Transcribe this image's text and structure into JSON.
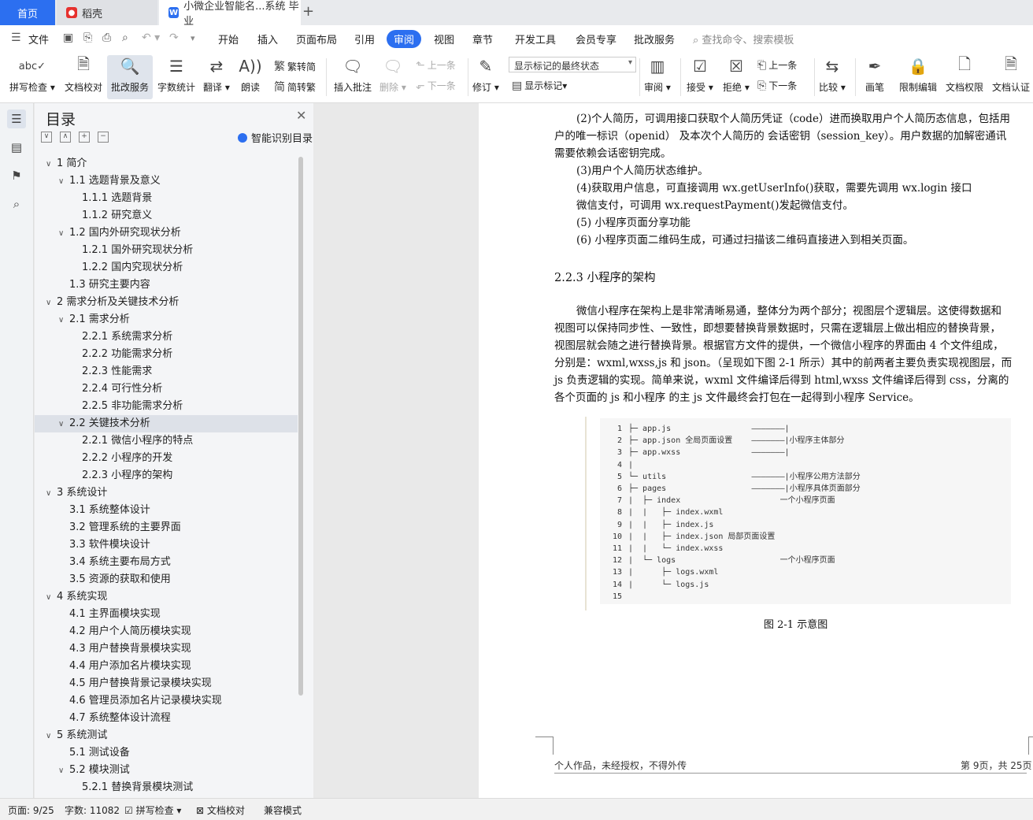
{
  "tabs": {
    "home": "首页",
    "docer": "稻壳",
    "doc": "小微企业智能名...系统 毕业",
    "add": "+"
  },
  "menu": {
    "file": "文件",
    "items": [
      "开始",
      "插入",
      "页面布局",
      "引用",
      "审阅",
      "视图",
      "章节",
      "开发工具",
      "会员专享",
      "批改服务"
    ],
    "active": "审阅",
    "search": "查找命令、搜索模板"
  },
  "ribbon": {
    "spellcheck": "拼写检查",
    "proofread": "文档校对",
    "correction_service": "批改服务",
    "word_count": "字数统计",
    "translate": "翻译",
    "read_aloud": "朗读",
    "trad": "繁转简",
    "simp": "简转繁",
    "insert_comment": "插入批注",
    "delete": "删除",
    "prev": "上一条",
    "next": "下一条",
    "track": "修订",
    "markup_state": "显示标记的最终状态",
    "show_markup": "显示标记",
    "review": "审阅",
    "accept": "接受",
    "reject": "拒绝",
    "prev2": "上一条",
    "next2": "下一条",
    "compare": "比较",
    "pen": "画笔",
    "restrict": "限制编辑",
    "doc_perm": "文档权限",
    "doc_auth": "文档认证"
  },
  "toc": {
    "title": "目录",
    "smart": "智能识别目录",
    "items": [
      {
        "text": "1  简介",
        "level": 0,
        "tw": "∨"
      },
      {
        "text": "1.1  选题背景及意义",
        "level": 1,
        "tw": "∨"
      },
      {
        "text": "1.1.1  选题背景",
        "level": 2,
        "tw": ""
      },
      {
        "text": "1.1.2  研究意义",
        "level": 2,
        "tw": ""
      },
      {
        "text": "1.2 国内外研究现状分析",
        "level": 1,
        "tw": "∨"
      },
      {
        "text": "1.2.1 国外研究现状分析",
        "level": 2,
        "tw": ""
      },
      {
        "text": "1.2.2 国内究现状分析",
        "level": 2,
        "tw": ""
      },
      {
        "text": "1.3  研究主要内容",
        "level": 1,
        "tw": ""
      },
      {
        "text": "2  需求分析及关键技术分析",
        "level": 0,
        "tw": "∨"
      },
      {
        "text": "2.1 需求分析",
        "level": 1,
        "tw": "∨"
      },
      {
        "text": "2.2.1 系统需求分析",
        "level": 2,
        "tw": ""
      },
      {
        "text": "2.2.2 功能需求分析",
        "level": 2,
        "tw": ""
      },
      {
        "text": "2.2.3 性能需求",
        "level": 2,
        "tw": ""
      },
      {
        "text": "2.2.4 可行性分析",
        "level": 2,
        "tw": ""
      },
      {
        "text": "2.2.5 非功能需求分析",
        "level": 2,
        "tw": ""
      },
      {
        "text": "2.2 关键技术分析",
        "level": 1,
        "tw": "∨",
        "selected": true
      },
      {
        "text": "2.2.1 微信小程序的特点",
        "level": 2,
        "tw": ""
      },
      {
        "text": "2.2.2 小程序的开发",
        "level": 2,
        "tw": ""
      },
      {
        "text": "2.2.3 小程序的架构",
        "level": 2,
        "tw": ""
      },
      {
        "text": "3  系统设计",
        "level": 0,
        "tw": "∨"
      },
      {
        "text": "3.1 系统整体设计",
        "level": 1,
        "tw": ""
      },
      {
        "text": "3.2 管理系统的主要界面",
        "level": 1,
        "tw": ""
      },
      {
        "text": "3.3 软件模块设计",
        "level": 1,
        "tw": ""
      },
      {
        "text": "3.4 系统主要布局方式",
        "level": 1,
        "tw": ""
      },
      {
        "text": "3.5 资源的获取和使用",
        "level": 1,
        "tw": ""
      },
      {
        "text": "4  系统实现",
        "level": 0,
        "tw": "∨"
      },
      {
        "text": "4.1 主界面模块实现",
        "level": 1,
        "tw": ""
      },
      {
        "text": "4.2 用户个人简历模块实现",
        "level": 1,
        "tw": ""
      },
      {
        "text": "4.3 用户替换背景模块实现",
        "level": 1,
        "tw": ""
      },
      {
        "text": "4.4 用户添加名片模块实现",
        "level": 1,
        "tw": ""
      },
      {
        "text": "4.5 用户替换背景记录模块实现",
        "level": 1,
        "tw": ""
      },
      {
        "text": "4.6 管理员添加名片记录模块实现",
        "level": 1,
        "tw": ""
      },
      {
        "text": "4.7 系统整体设计流程",
        "level": 1,
        "tw": ""
      },
      {
        "text": "5  系统测试",
        "level": 0,
        "tw": "∨"
      },
      {
        "text": "5.1  测试设备",
        "level": 1,
        "tw": ""
      },
      {
        "text": "5.2  模块测试",
        "level": 1,
        "tw": "∨"
      },
      {
        "text": "5.2.1 替换背景模块测试",
        "level": 2,
        "tw": ""
      }
    ]
  },
  "doc": {
    "lines": [
      "(2)个人简历，可调用接口获取个人简历凭证（code）进而换取用户个人简历态信息，包括用",
      "户的唯一标识（openid） 及本次个人简历的 会话密钥（session_key）。用户数据的加解密通讯",
      "需要依赖会话密钥完成。",
      "(3)用户个人简历状态维护。",
      "(4)获取用户信息，可直接调用  wx.getUserInfo()获取，需要先调用  wx.login  接口",
      "微信支付，可调用  wx.requestPayment()发起微信支付。",
      "(5)  小程序页面分享功能",
      "(6)  小程序页面二维码生成，可通过扫描该二维码直接进入到相关页面。"
    ],
    "heading": "2.2.3 小程序的架构",
    "para": [
      "微信小程序在架构上是非常清晰易通，整体分为两个部分；视图层个逻辑层。这使得数据和",
      "视图可以保持同步性、一致性，即想要替换背景数据时，只需在逻辑层上做出相应的替换背景，",
      "视图层就会随之进行替换背景。根据官方文件的提供，一个微信小程序的界面由 4 个文件组成，",
      "分别是：wxml,wxss,js  和  json。（呈现如下图 2-1 所示）其中的前两者主要负责实现视图层，而",
      "js  负责逻辑的实现。简单来说，wxml  文件编译后得到  html,wxss  文件编译后得到  css，分离的",
      "各个页面的 js 和小程序  的主  js  文件最终会打包在一起得到小程序  Service。"
    ],
    "code": [
      {
        "n": "1",
        "t": "├─ app.js                 ———————|"
      },
      {
        "n": "2",
        "t": "├─ app.json 全局页面设置    ———————|小程序主体部分"
      },
      {
        "n": "3",
        "t": "├─ app.wxss               ———————|"
      },
      {
        "n": "4",
        "t": "|"
      },
      {
        "n": "5",
        "t": "└─ utils                  ———————|小程序公用方法部分"
      },
      {
        "n": "6",
        "t": "├─ pages                  ———————|小程序具体页面部分"
      },
      {
        "n": "7",
        "t": "|  ├─ index                     一个小程序页面"
      },
      {
        "n": "8",
        "t": "|  |   ├─ index.wxml"
      },
      {
        "n": "9",
        "t": "|  |   ├─ index.js"
      },
      {
        "n": "10",
        "t": "|  |   ├─ index.json 局部页面设置"
      },
      {
        "n": "11",
        "t": "|  |   └─ index.wxss"
      },
      {
        "n": "12",
        "t": "|  └─ logs                      一个小程序页面"
      },
      {
        "n": "13",
        "t": "|      ├─ logs.wxml"
      },
      {
        "n": "14",
        "t": "|      └─ logs.js"
      },
      {
        "n": "15",
        "t": ""
      }
    ],
    "caption": "图 2-1  示意图",
    "footer_left": "个人作品，未经授权，不得外传",
    "footer_right": "第 9页，共 25页"
  },
  "status": {
    "page": "页面: 9/25",
    "words": "字数: 11082",
    "spell": "拼写检查",
    "proof": "文档校对",
    "compat": "兼容模式"
  },
  "colors": {
    "accent": "#2c6ff0"
  }
}
